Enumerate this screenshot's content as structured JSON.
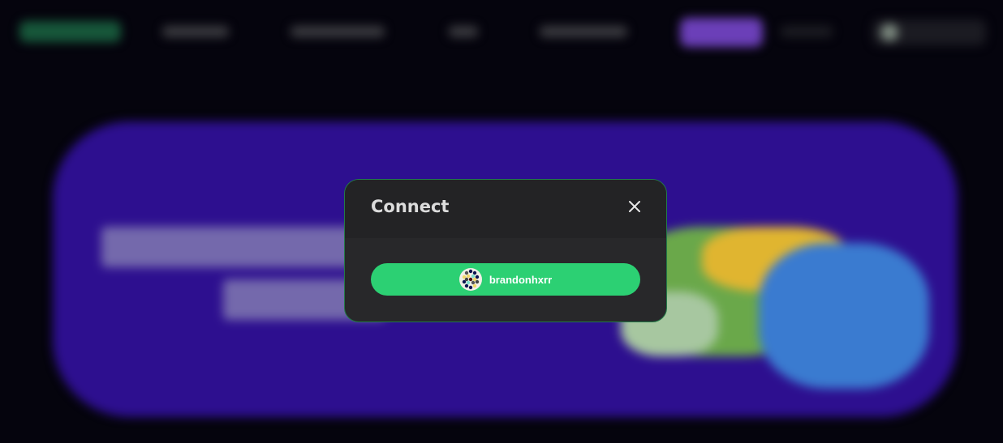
{
  "modal": {
    "title": "Connect",
    "close_icon": "close-icon",
    "account": {
      "username": "brandonhxrr",
      "avatar_icon": "dotted-avatar-icon"
    }
  },
  "colors": {
    "accent": "#2cd073",
    "banner": "#2d0f8f",
    "background": "#05040d",
    "cta": "#6b3fb8"
  }
}
